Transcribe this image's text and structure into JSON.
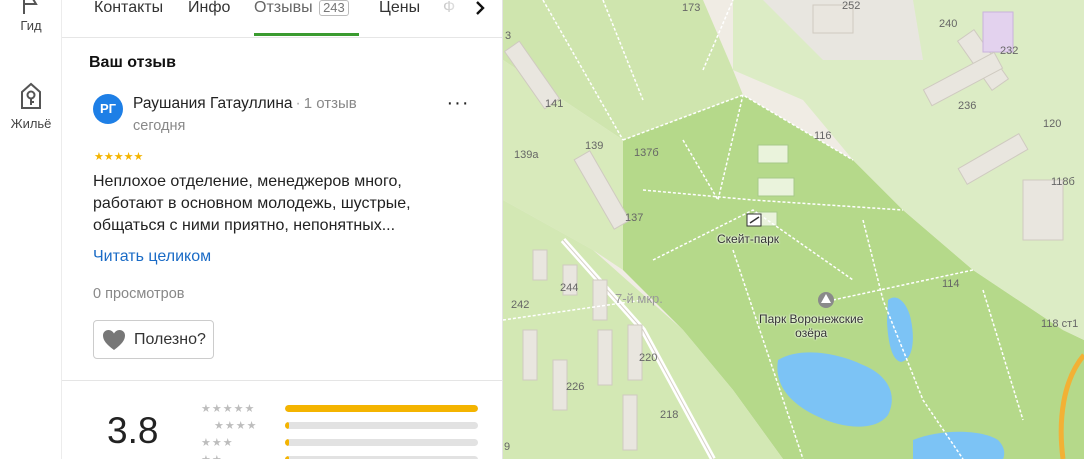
{
  "rail": {
    "items": [
      {
        "label": "Гид",
        "icon": "flag-icon"
      },
      {
        "label": "Жильё",
        "icon": "house-key-icon"
      }
    ]
  },
  "tabs": [
    {
      "label": "Контакты"
    },
    {
      "label": "Инфо"
    },
    {
      "label": "Отзывы",
      "badge": "243",
      "active": true
    },
    {
      "label": "Цены"
    },
    {
      "label": "Ф"
    }
  ],
  "section_title": "Ваш отзыв",
  "review": {
    "avatar_initials": "РГ",
    "author": "Раушания Гатауллина",
    "separator": "·",
    "reviews_count": "1 отзыв",
    "date": "сегодня",
    "more": "···",
    "stars": "★★★★★",
    "text_line1": "Неплохое отделение, менеджеров много,",
    "text_line2": "работают в основном молодежь, шустрые,",
    "text_line3": "общаться с ними приятно, непонятных...",
    "read_more": "Читать целиком",
    "views": "0 просмотров",
    "useful_label": "Полезно?"
  },
  "summary": {
    "rating": "3.8",
    "rows": [
      {
        "stars": "★★★★★",
        "fraction": 1.0
      },
      {
        "stars": "★★★★",
        "fraction": 0.02
      },
      {
        "stars": "★★★",
        "fraction": 0.02
      },
      {
        "stars": "★★",
        "fraction": 0.02
      }
    ]
  },
  "map": {
    "numbers": {
      "n173": "173",
      "n252": "252",
      "n240": "240",
      "n232": "232",
      "n141": "141",
      "n116": "116",
      "n236": "236",
      "n120": "120",
      "n139": "139",
      "n137b": "137б",
      "n139a": "139а",
      "n118b": "118б",
      "n137": "137",
      "n244": "244",
      "n242": "242",
      "n114": "114",
      "n118st1": "118 ст1",
      "n220": "220",
      "n226": "226",
      "n218": "218",
      "n3": "3",
      "n9": "9"
    },
    "district": "7-й мкр.",
    "skate_park": "Скейт-парк",
    "park_line1": "Парк Воронежские",
    "park_line2": "озёра"
  },
  "colors": {
    "accent_green": "#3a9b2f",
    "link_blue": "#1a6bc6",
    "star_yellow": "#f4b400",
    "avatar_blue": "#1e7fe6",
    "park_green": "#b5d98a",
    "water_blue": "#7cc3f5"
  }
}
